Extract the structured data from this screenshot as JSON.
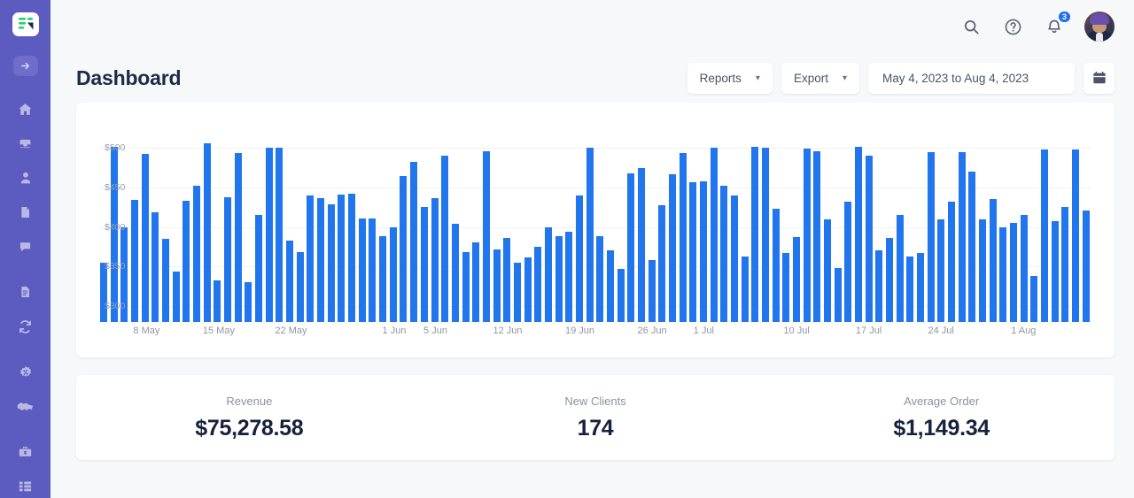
{
  "brand": {
    "logo_icon": "app-logo-icon",
    "sidebar_color": "#5c5bbf",
    "accent_color": "#2176ee"
  },
  "sidebar": {
    "items": [
      {
        "icon": "login-arrow-icon",
        "boxed": true
      },
      {
        "icon": "home-icon",
        "boxed": false
      },
      {
        "icon": "inbox-icon",
        "boxed": false
      },
      {
        "icon": "user-icon",
        "boxed": false
      },
      {
        "icon": "document-icon",
        "boxed": false
      },
      {
        "icon": "chat-bubble-icon",
        "boxed": false
      },
      {
        "icon": "file-text-icon",
        "boxed": false
      },
      {
        "icon": "refresh-sync-icon",
        "boxed": false
      },
      {
        "icon": "discount-badge-icon",
        "boxed": false
      },
      {
        "icon": "handshake-icon",
        "boxed": false
      },
      {
        "icon": "toolbox-icon",
        "boxed": false
      },
      {
        "icon": "grid-list-icon",
        "boxed": false
      }
    ]
  },
  "topbar": {
    "search_icon": "search-icon",
    "help_icon": "help-circle-icon",
    "notifications_icon": "bell-icon",
    "notifications_count": "3",
    "avatar": "user-avatar"
  },
  "header": {
    "title": "Dashboard"
  },
  "toolbar": {
    "reports_label": "Reports",
    "export_label": "Export",
    "date_range": "May 4, 2023 to Aug 4, 2023",
    "calendar_icon": "calendar-icon",
    "caret_icon": "chevron-down-icon"
  },
  "stats": [
    {
      "label": "Revenue",
      "value": "$75,278.58"
    },
    {
      "label": "New Clients",
      "value": "174"
    },
    {
      "label": "Average Order",
      "value": "$1,149.34"
    }
  ],
  "chart_data": {
    "type": "bar",
    "title": "",
    "xlabel": "",
    "ylabel": "",
    "ylim": [
      280,
      510
    ],
    "grid": true,
    "legend": null,
    "bar_color": "#2176ee",
    "yticks": [
      500,
      450,
      400,
      350,
      300
    ],
    "ytick_labels": [
      "$500",
      "$450",
      "$400",
      "$350",
      "$300"
    ],
    "xtick_labels": [
      "8 May",
      "15 May",
      "22 May",
      "1 Jun",
      "5 Jun",
      "12 Jun",
      "19 Jun",
      "26 Jun",
      "1 Jul",
      "10 Jul",
      "17 Jul",
      "24 Jul",
      "1 Aug"
    ],
    "xtick_indices": [
      4,
      11,
      18,
      28,
      32,
      39,
      46,
      53,
      58,
      67,
      74,
      81,
      89
    ],
    "values": [
      355,
      501,
      400,
      434,
      492,
      419,
      385,
      344,
      433,
      452,
      506,
      333,
      437,
      493,
      330,
      415,
      500,
      500,
      383,
      368,
      440,
      436,
      428,
      441,
      442,
      411,
      411,
      388,
      400,
      464,
      482,
      425,
      436,
      490,
      404,
      368,
      381,
      496,
      372,
      386,
      355,
      362,
      375,
      399,
      388,
      394,
      440,
      500,
      388,
      371,
      347,
      468,
      474,
      358,
      427,
      467,
      493,
      456,
      457,
      500,
      452,
      440,
      363,
      501,
      500,
      423,
      367,
      387,
      499,
      495,
      410,
      348,
      432,
      501,
      490,
      370,
      386,
      415,
      363,
      367,
      494,
      409,
      432,
      494,
      470,
      410,
      435,
      400,
      405,
      415,
      338,
      498,
      407,
      425,
      498,
      421
    ]
  }
}
